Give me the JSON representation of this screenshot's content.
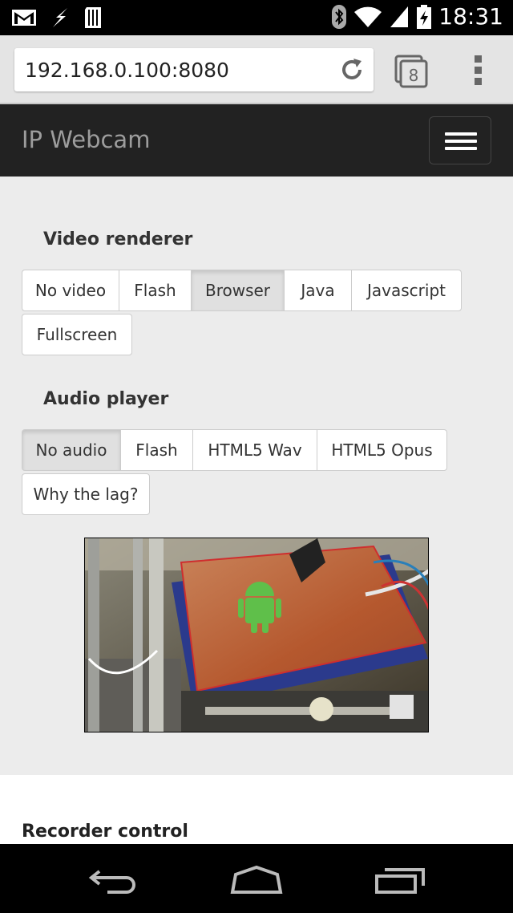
{
  "status_bar": {
    "time": "18:31",
    "icons": [
      "gmail-icon",
      "flash-icon",
      "sd-card-icon",
      "bluetooth-icon",
      "wifi-icon",
      "signal-icon",
      "battery-icon"
    ]
  },
  "browser": {
    "url": "192.168.0.100:8080",
    "tab_count": "8"
  },
  "app": {
    "brand": "IP Webcam"
  },
  "video_renderer": {
    "title": "Video renderer",
    "options": [
      "No video",
      "Flash",
      "Browser",
      "Java",
      "Javascript",
      "Fullscreen"
    ],
    "selected": "Browser"
  },
  "audio_player": {
    "title": "Audio player",
    "options": [
      "No audio",
      "Flash",
      "HTML5 Wav",
      "HTML5 Opus",
      "Why the lag?"
    ],
    "selected": "No audio"
  },
  "recorder": {
    "title": "Recorder control"
  },
  "colors": {
    "navbar_bg": "#222222",
    "page_bg": "#ececec",
    "brand_text": "#9d9d9d"
  }
}
